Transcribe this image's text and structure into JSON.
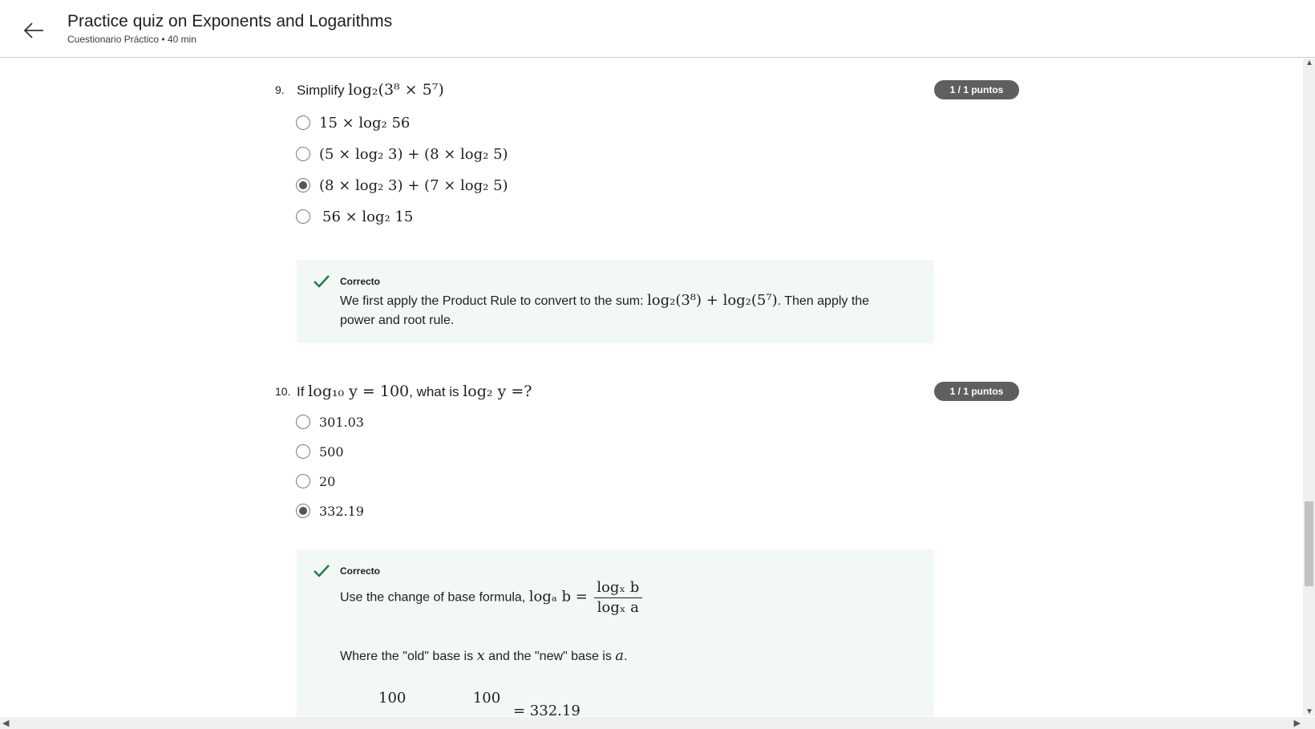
{
  "header": {
    "title": "Practice quiz on Exponents and Logarithms",
    "subtitle": "Cuestionario Práctico • 40 min"
  },
  "questions": [
    {
      "number": "9.",
      "prefix": "Simplify ",
      "question_math": "log₂(3⁸ × 5⁷)",
      "suffix": "",
      "points": "1 / 1 puntos",
      "options": [
        {
          "label": "15 × log₂ 56",
          "selected": false
        },
        {
          "label": "(5 × log₂ 3) + (8 × log₂ 5)",
          "selected": false
        },
        {
          "label": "(8 × log₂ 3) + (7 × log₂ 5)",
          "selected": true
        },
        {
          "label": "56 × log₂ 15",
          "selected": false
        }
      ],
      "feedback": {
        "status": "Correcto",
        "text_before": "We first apply the Product Rule to convert to the sum: ",
        "math": "log₂(3⁸) + log₂(5⁷)",
        "text_after": ". Then apply the",
        "line2": "power and root rule."
      }
    },
    {
      "number": "10.",
      "prefix": "If ",
      "question_math": "log₁₀ y = 100",
      "middle": ", what is ",
      "question_math2": "log₂ y =?",
      "points": "1 / 1 puntos",
      "options": [
        {
          "label": "301.03",
          "selected": false
        },
        {
          "label": "500",
          "selected": false
        },
        {
          "label": "20",
          "selected": false
        },
        {
          "label": "332.19",
          "selected": true
        }
      ],
      "feedback": {
        "status": "Correcto",
        "text_before": "Use the change of base formula, ",
        "formula_lhs": "logₐ b =",
        "formula_num": "logₓ b",
        "formula_den": "logₓ a",
        "line2_before": "Where the \"old\" base is ",
        "line2_x": "x",
        "line2_mid": " and the \"new\" base is ",
        "line2_a": "a",
        "line2_after": ".",
        "partial_num1": "100",
        "partial_num2": "100",
        "partial_result": "= 332.19"
      }
    }
  ]
}
